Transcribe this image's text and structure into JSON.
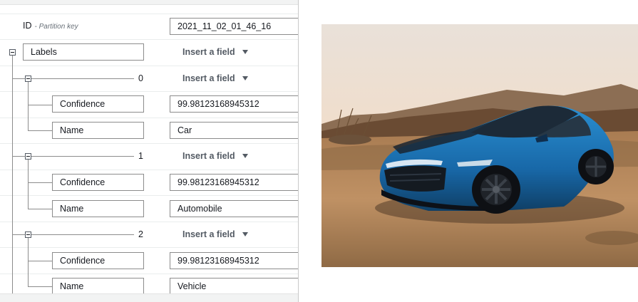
{
  "partition_key": {
    "label": "ID",
    "annotation": "- Partition key",
    "value": "2021_11_02_01_46_16"
  },
  "labels_map": {
    "key": "Labels",
    "insert_field_label": "Insert a field",
    "items": [
      {
        "index": "0",
        "insert_field_label": "Insert a field",
        "confidence_key": "Confidence",
        "confidence_value": "99.98123168945312",
        "name_key": "Name",
        "name_value": "Car"
      },
      {
        "index": "1",
        "insert_field_label": "Insert a field",
        "confidence_key": "Confidence",
        "confidence_value": "99.98123168945312",
        "name_key": "Name",
        "name_value": "Automobile"
      },
      {
        "index": "2",
        "insert_field_label": "Insert a field",
        "confidence_key": "Confidence",
        "confidence_value": "99.98123168945312",
        "name_key": "Name",
        "name_value": "Vehicle"
      }
    ]
  },
  "image_preview": {
    "icon": "car-photo",
    "colors": {
      "sky": "#f1dcc8",
      "car": "#1d6fb3",
      "ground": "#b98855"
    }
  }
}
